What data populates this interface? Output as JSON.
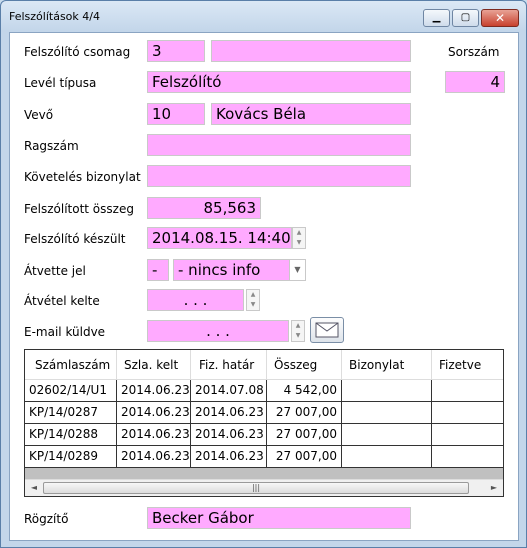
{
  "window": {
    "title": "Felszólítások   4/4"
  },
  "labels": {
    "package": "Felszólító csomag",
    "serial": "Sorszám",
    "letter_type": "Levél típusa",
    "buyer": "Vevő",
    "rag": "Ragszám",
    "doc": "Követelés bizonylat",
    "amount": "Felszólított összeg",
    "created": "Felszólító készült",
    "received": "Átvette jel",
    "received_date": "Átvétel kelte",
    "email": "E-mail küldve",
    "recorder": "Rögzítő"
  },
  "fields": {
    "package_id": "3",
    "package_name": "",
    "serial": "4",
    "letter_type": "Felszólító",
    "buyer_id": "10",
    "buyer_name": "Kovács Béla",
    "rag": "",
    "doc": "",
    "amount": "85,563",
    "created": "2014.08.15. 14:40",
    "received_code": "-",
    "received_desc": "- nincs info",
    "received_date": ". . .",
    "email_date": ". . .",
    "recorder": "Becker Gábor"
  },
  "table": {
    "headers": [
      "Számlaszám",
      "Szla. kelt",
      "Fiz. határ",
      "Összeg",
      "Bizonylat",
      "Fizetve"
    ],
    "rows": [
      [
        "02602/14/U1",
        "2014.06.23",
        "2014.07.08",
        "4 542,00",
        "",
        ""
      ],
      [
        "KP/14/0287",
        "2014.06.23",
        "2014.06.23",
        "27 007,00",
        "",
        ""
      ],
      [
        "KP/14/0288",
        "2014.06.23",
        "2014.06.23",
        "27 007,00",
        "",
        ""
      ],
      [
        "KP/14/0289",
        "2014.06.23",
        "2014.06.23",
        "27 007,00",
        "",
        ""
      ]
    ]
  },
  "colors": {
    "field_bg": "#ffaaff",
    "window_bg": "#c9dced"
  },
  "icons": {
    "email": "envelope-icon",
    "minimize": "minimize-icon",
    "maximize": "maximize-icon",
    "close": "close-icon"
  }
}
